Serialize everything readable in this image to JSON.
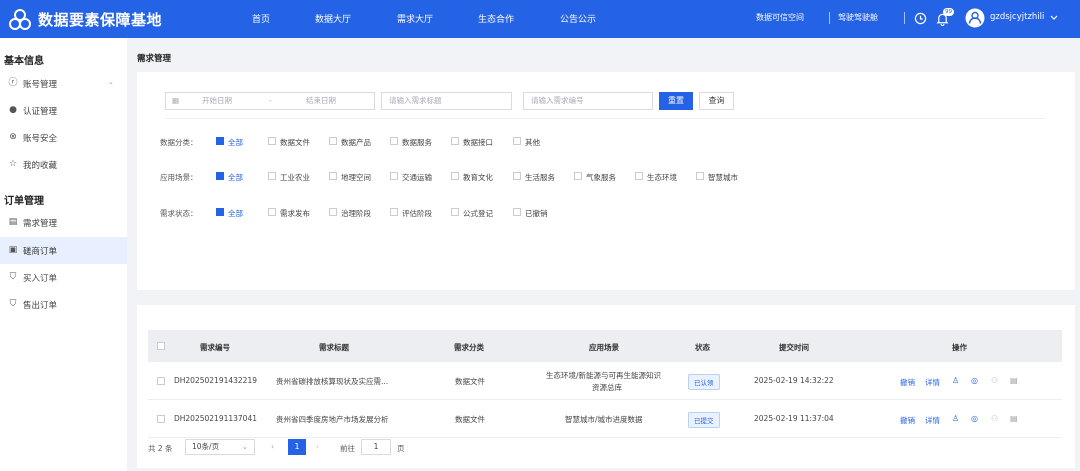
{
  "header": {
    "title": "数据要素保障基地",
    "nav": [
      "首页",
      "数据大厅",
      "需求大厅",
      "生态合作",
      "公告公示"
    ],
    "right_links": [
      "数据可信空间",
      "驾驶驾驶舱"
    ],
    "badge": "99",
    "username": "gzdsjcyjtzhili"
  },
  "sidebar": {
    "sections": [
      "基本信息",
      "订单管理"
    ],
    "items": [
      {
        "label": "账号管理",
        "icon": "user-icon"
      },
      {
        "label": "认证管理",
        "icon": "person-icon"
      },
      {
        "label": "账号安全",
        "icon": "shield-icon"
      },
      {
        "label": "我的收藏",
        "icon": "star-icon"
      },
      {
        "label": "需求管理",
        "icon": "doc-icon"
      },
      {
        "label": "磋商订单",
        "icon": "order-icon"
      },
      {
        "label": "买入订单",
        "icon": "cart-icon"
      },
      {
        "label": "售出订单",
        "icon": "cart-icon"
      }
    ]
  },
  "page": {
    "title": "需求管理"
  },
  "filters": {
    "start_placeholder": "开始日期",
    "end_placeholder": "结束日期",
    "date_sep": "-",
    "title_placeholder": "请输入需求标题",
    "number_placeholder": "请输入需求编号",
    "reset": "重置",
    "search": "查询",
    "category": {
      "label": "数据分类：",
      "options": [
        "全部",
        "数据文件",
        "数据产品",
        "数据服务",
        "数据接口",
        "其他"
      ]
    },
    "scene": {
      "label": "应用场景：",
      "options": [
        "全部",
        "工业农业",
        "地理空间",
        "交通运输",
        "教育文化",
        "生活服务",
        "气象服务",
        "生态环境",
        "智慧城市"
      ]
    },
    "status": {
      "label": "需求状态：",
      "options": [
        "全部",
        "需求发布",
        "治理阶段",
        "评估阶段",
        "公式登记",
        "已撤销"
      ]
    }
  },
  "table": {
    "headers": [
      "需求编号",
      "需求标题",
      "需求分类",
      "应用场景",
      "状态",
      "提交时间",
      "操作"
    ],
    "rows": [
      {
        "id": "DH202502191432219",
        "title": "贵州省碳排放核算现状及实应需...",
        "category": "数据文件",
        "scene_line1": "生态环境/新能源与可再生能源知识",
        "scene_line2": "资源总库",
        "status": "已认领",
        "time": "2025-02-19 14:32:22",
        "op1": "撤销",
        "op2": "详情"
      },
      {
        "id": "DH202502191137041",
        "title": "贵州省四季度房地产市场发展分析",
        "category": "数据文件",
        "scene_line1": "智慧城市/城市进度数据",
        "scene_line2": "",
        "status": "已提交",
        "time": "2025-02-19 11:37:04",
        "op1": "撤销",
        "op2": "详情"
      }
    ]
  },
  "pagination": {
    "total": "共 2 条",
    "page_size": "10条/页",
    "current": "1",
    "goto_label": "前往",
    "goto_value": "1",
    "page_unit": "页"
  }
}
